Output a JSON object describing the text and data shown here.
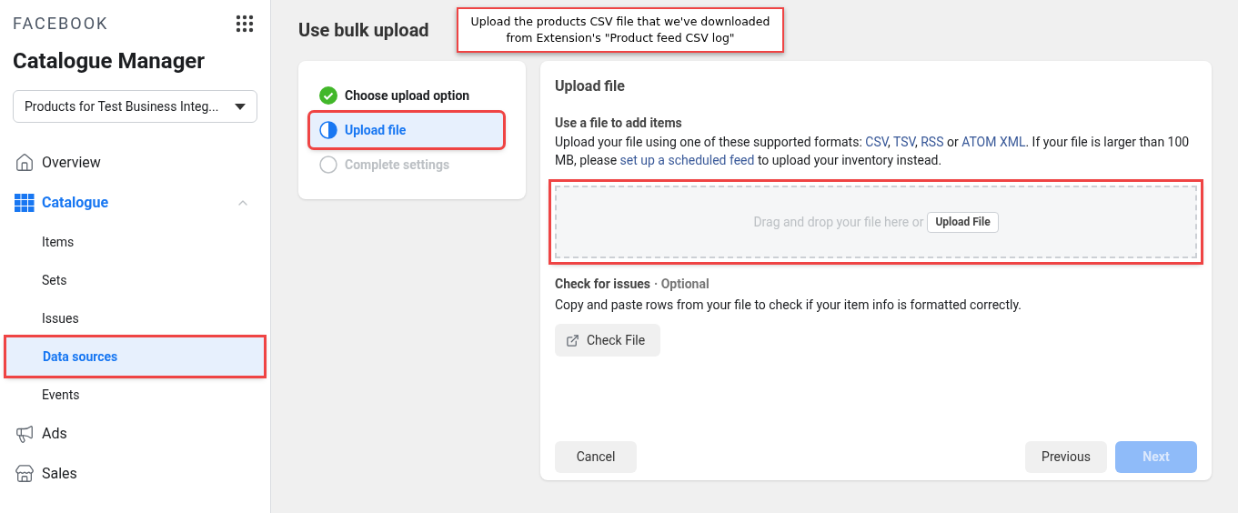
{
  "sidebar": {
    "brand": "FACEBOOK",
    "app_title": "Catalogue Manager",
    "catalogue_selector": {
      "value": "Products for Test Business Integ..."
    },
    "nav": [
      {
        "label": "Overview",
        "selected": false
      },
      {
        "label": "Catalogue",
        "selected": true,
        "expanded": true,
        "children": [
          {
            "label": "Items",
            "selected": false,
            "highlighted": false
          },
          {
            "label": "Sets",
            "selected": false,
            "highlighted": false
          },
          {
            "label": "Issues",
            "selected": false,
            "highlighted": false
          },
          {
            "label": "Data sources",
            "selected": true,
            "highlighted": true
          },
          {
            "label": "Events",
            "selected": false,
            "highlighted": false
          }
        ]
      },
      {
        "label": "Ads",
        "selected": false
      },
      {
        "label": "Sales",
        "selected": false
      }
    ]
  },
  "page_title": "Use bulk upload",
  "annotation": {
    "lines": [
      "Upload the products CSV file that we've downloaded",
      "from Extension's \"Product feed CSV log\""
    ]
  },
  "steps": [
    {
      "label": "Choose upload option",
      "kind": "done",
      "highlighted": false
    },
    {
      "label": "Upload file",
      "kind": "current",
      "highlighted": true
    },
    {
      "label": "Complete settings",
      "kind": "pending",
      "highlighted": false
    }
  ],
  "upload_panel": {
    "title": "Upload file",
    "heading": "Use a file to add items",
    "description": [
      {
        "text": "Upload your file using one of these supported formats: ",
        "kind": "text"
      },
      {
        "text": "CSV",
        "kind": "link"
      },
      {
        "text": ", ",
        "kind": "text"
      },
      {
        "text": "TSV",
        "kind": "link"
      },
      {
        "text": ", ",
        "kind": "text"
      },
      {
        "text": "RSS",
        "kind": "link"
      },
      {
        "text": " or ",
        "kind": "text"
      },
      {
        "text": "ATOM XML",
        "kind": "link"
      },
      {
        "text": ". If your file is larger than 100 MB, please ",
        "kind": "text"
      },
      {
        "text": "set up a scheduled feed",
        "kind": "link"
      },
      {
        "text": " to upload your inventory instead.",
        "kind": "text"
      }
    ],
    "dropzone": {
      "text": "Drag and drop your file here or",
      "button": "Upload File",
      "highlighted": true
    },
    "check": {
      "heading": "Check for issues",
      "optional": "· Optional",
      "description": "Copy and paste rows from your file to check if your item info is formatted correctly.",
      "button": "Check File"
    },
    "footer": {
      "cancel": "Cancel",
      "previous": "Previous",
      "next": {
        "label": "Next",
        "disabled": true
      }
    }
  }
}
